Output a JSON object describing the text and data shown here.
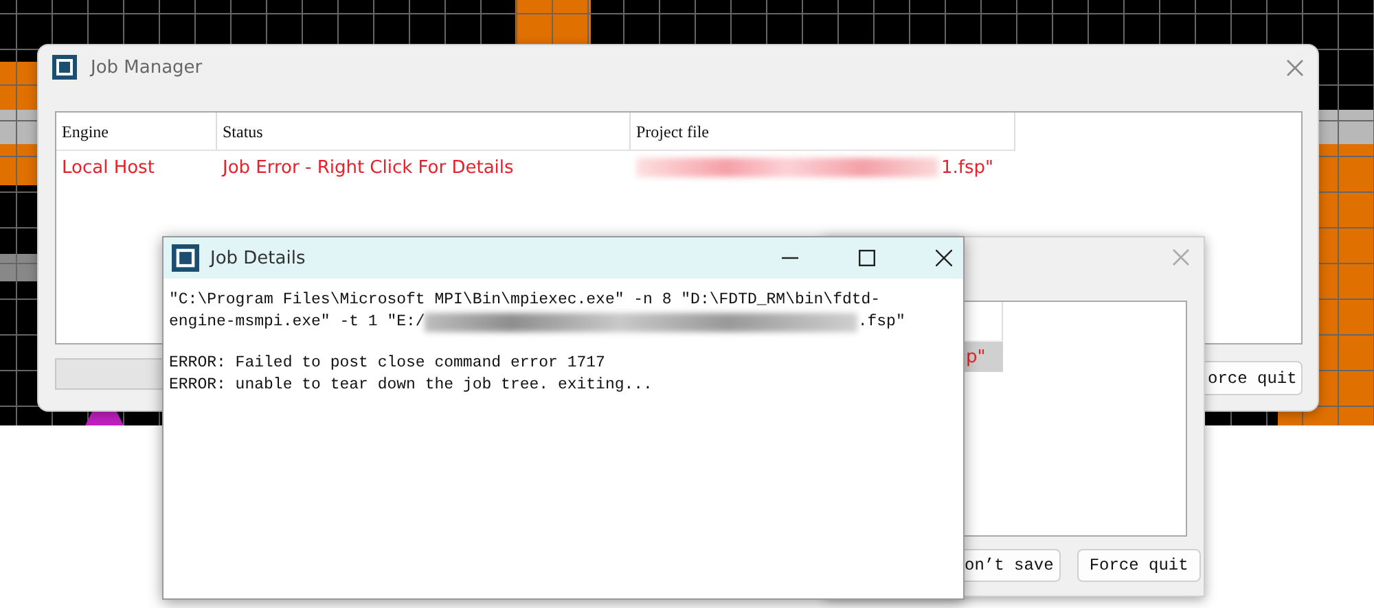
{
  "job_manager": {
    "title": "Job Manager",
    "table": {
      "columns": [
        "Engine",
        "Status",
        "Project file"
      ],
      "rows": [
        {
          "engine": "Local Host",
          "status": "Job Error - Right Click For Details",
          "project_file": "1.fsp\"",
          "error": true
        }
      ]
    },
    "button": "orce quit"
  },
  "dialog_behind": {
    "cell": "p\"",
    "buttons": [
      "on’t save",
      "Force quit"
    ]
  },
  "job_details": {
    "title": "Job Details",
    "command_lines": [
      "\"C:\\Program Files\\Microsoft MPI\\Bin\\mpiexec.exe\" -n 8 \"D:\\FDTD_RM\\bin\\fdtd-",
      "engine-msmpi.exe\" -t 1 \"E:/"
    ],
    "command_tail": ".fsp\"",
    "errors": [
      "ERROR: Failed to post close command error 1717",
      "ERROR: unable to tear down the job tree. exiting..."
    ]
  }
}
